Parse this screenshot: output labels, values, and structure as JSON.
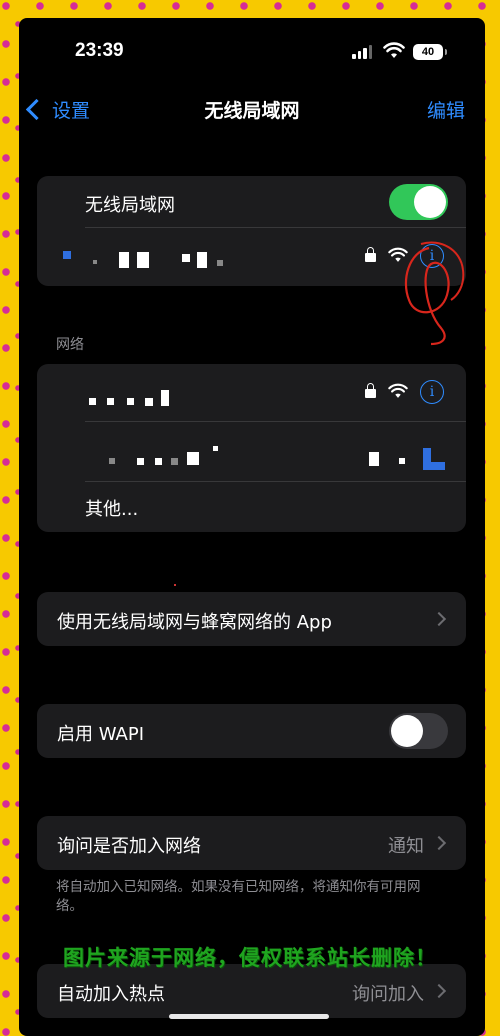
{
  "status": {
    "time": "23:39",
    "battery": "40"
  },
  "nav": {
    "back_label": "设置",
    "title": "无线局域网",
    "edit_label": "编辑"
  },
  "wifi_group": {
    "wifi_label": "无线局域网",
    "wifi_enabled": true
  },
  "networks": {
    "section_label": "网络",
    "other_label": "其他..."
  },
  "app_row": {
    "label": "使用无线局域网与蜂窝网络的 App"
  },
  "wapi": {
    "label": "启用 WAPI",
    "enabled": false
  },
  "ask_join": {
    "label": "询问是否加入网络",
    "value": "通知",
    "note": "将自动加入已知网络。如果没有已知网络，将通知你有可用网络。"
  },
  "hotspot": {
    "label": "自动加入热点",
    "value": "询问加入"
  },
  "watermark": "图片来源于网络，侵权联系站长删除！",
  "colors": {
    "accent": "#2f8cff",
    "toggle_on": "#31c759",
    "background": "#000000",
    "cell": "#1c1c1e"
  }
}
